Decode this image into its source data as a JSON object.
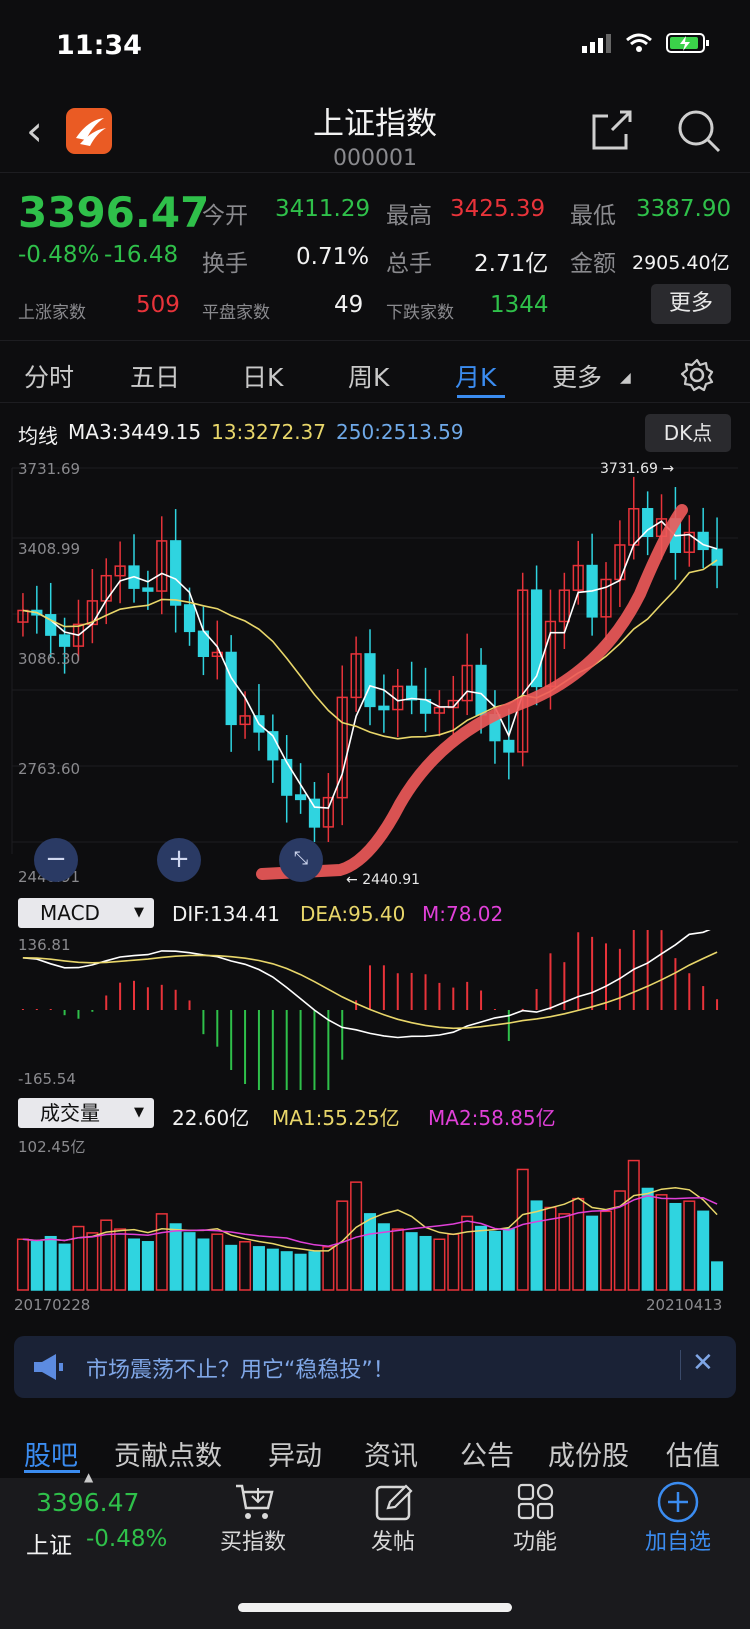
{
  "status": {
    "time": "11:34"
  },
  "nav": {
    "title": "上证指数",
    "code": "000001"
  },
  "quote": {
    "price": "3396.47",
    "change_pct": "-0.48%",
    "change": "-16.48",
    "open_label": "今开",
    "open": "3411.29",
    "high_label": "最高",
    "high": "3425.39",
    "low_label": "最低",
    "low": "3387.90",
    "turnover_label": "换手",
    "turnover": "0.71%",
    "volume_label": "总手",
    "volume": "2.71亿",
    "amount_label": "金额",
    "amount": "2905.40亿",
    "up_label": "上涨家数",
    "up": "509",
    "flat_label": "平盘家数",
    "flat": "49",
    "down_label": "下跌家数",
    "down": "1344",
    "more": "更多"
  },
  "tabs": [
    "分时",
    "五日",
    "日K",
    "周K",
    "月K",
    "更多"
  ],
  "active_tab": "月K",
  "ma": {
    "label": "均线",
    "ma3": "MA3:3449.15",
    "ma13": "13:3272.37",
    "ma250": "250:2513.59",
    "ma3_color": "#ffffff",
    "ma13_color": "#e8d66a",
    "ma250_color": "#6fa9e8"
  },
  "dk_button": "DK点",
  "kline_axis": [
    "3731.69",
    "3408.99",
    "3086.30",
    "2763.60",
    "2440.91"
  ],
  "kline_marks": {
    "high": "3731.69",
    "low": "2440.91"
  },
  "macd": {
    "selector": "MACD",
    "dif": "DIF:134.41",
    "dea": "DEA:95.40",
    "m": "M:78.02",
    "axis_top": "136.81",
    "axis_bottom": "-165.54"
  },
  "volume": {
    "selector": "成交量",
    "value": "22.60亿",
    "ma1": "MA1:55.25亿",
    "ma2": "MA2:58.85亿",
    "axis_top": "102.45亿",
    "date_start": "20170228",
    "date_end": "20210413"
  },
  "banner": {
    "text": "市场震荡不止？用它“稳稳投”！"
  },
  "bottom_tabs": [
    "股吧",
    "贡献点数",
    "异动",
    "资讯",
    "公告",
    "成份股",
    "估值"
  ],
  "toolbar": {
    "index_price": "3396.47",
    "index_name": "上证",
    "index_change": "-0.48%",
    "buy": "买指数",
    "post": "发帖",
    "function": "功能",
    "add": "加自选"
  },
  "chart_data": {
    "type": "candlestick",
    "period": "monthly",
    "x_range": [
      "20170228",
      "20210413"
    ],
    "ylim": [
      2440.91,
      3731.69
    ],
    "high": 3731.69,
    "low": 2440.91,
    "close_last": 3396.47,
    "colors": {
      "up": "#e8333a",
      "down": "#2fd4e0"
    }
  }
}
